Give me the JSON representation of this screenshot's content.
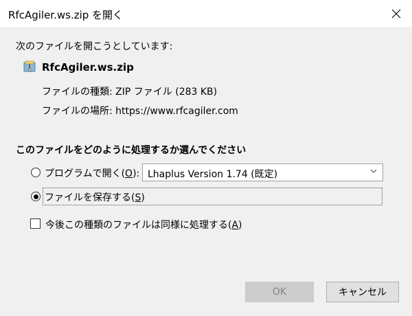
{
  "window": {
    "title": "RfcAgiler.ws.zip を開く"
  },
  "dialog": {
    "intro": "次のファイルを開こうとしています:",
    "file": {
      "name": "RfcAgiler.ws.zip",
      "type_label": "ファイルの種類:",
      "type_value": "ZIP ファイル (283 KB)",
      "source_label": "ファイルの場所:",
      "source_value": "https://www.rfcagiler.com"
    },
    "question": "このファイルをどのように処理するか選んでください",
    "options": {
      "open_with": {
        "label": "プログラムで開く(",
        "accesskey": "O",
        "suffix": "):",
        "selected": false,
        "program": "Lhaplus Version 1.74 (既定)"
      },
      "save": {
        "label": "ファイルを保存する(",
        "accesskey": "S",
        "suffix": ")",
        "selected": true
      },
      "remember": {
        "label": "今後この種類のファイルは同様に処理する(",
        "accesskey": "A",
        "suffix": ")",
        "checked": false
      }
    },
    "buttons": {
      "ok": "OK",
      "cancel": "キャンセル"
    }
  },
  "icons": {
    "close": "close-icon",
    "file": "zip-archive-icon",
    "dropdown": "chevron-down-icon"
  },
  "colors": {
    "dialog_bg": "#f0f0f0",
    "titlebar_bg": "#ffffff",
    "ok_disabled_bg": "#cccccc",
    "ok_disabled_text": "#838383",
    "cancel_bg": "#e1e1e1"
  }
}
